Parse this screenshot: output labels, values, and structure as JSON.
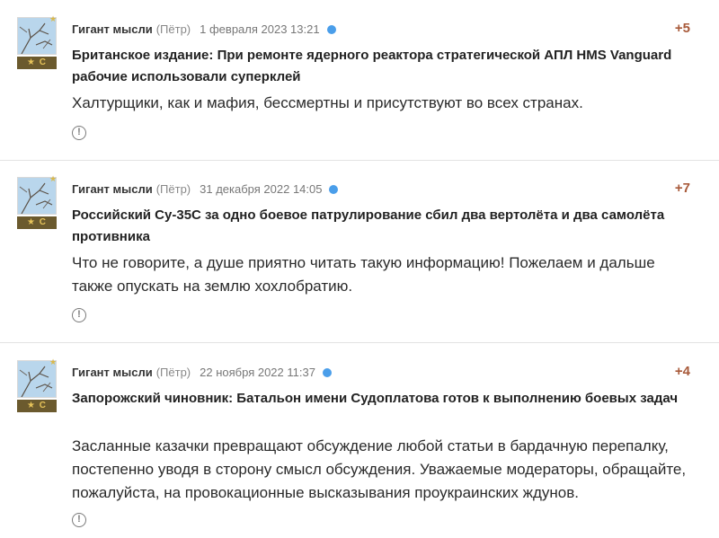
{
  "comments": [
    {
      "author": "Гигант мысли",
      "real_name": "(Пётр)",
      "date": "1 февраля 2023 13:21",
      "rating": "+5",
      "rank_badge": "★ С",
      "title": "Британское издание: При ремонте ядерного реактора стратегической АПЛ HMS Vanguard рабочие использовали суперклей",
      "text": "Халтурщики, как и мафия, бессмертны и присутствуют во всех странах.",
      "report_icon": "alert-circle-icon"
    },
    {
      "author": "Гигант мысли",
      "real_name": "(Пётр)",
      "date": "31 декабря 2022 14:05",
      "rating": "+7",
      "rank_badge": "★ С",
      "title": "Российский Су-35С за одно боевое патрулирование сбил два вертолёта и два самолёта противника",
      "text": "Что не говорите, а душе приятно читать такую информацию! Пожелаем и дальше также опускать на землю хохлобратию.",
      "report_icon": "alert-circle-icon"
    },
    {
      "author": "Гигант мысли",
      "real_name": "(Пётр)",
      "date": "22 ноября 2022 11:37",
      "rating": "+4",
      "rank_badge": "★ С",
      "title": "Запорожский чиновник: Батальон имени Судоплатова готов к выполнению боевых задач",
      "text": "Засланные казачки превращают обсуждение любой статьи в бардачную перепалку, постепенно уводя в сторону смысл обсуждения. Уважаемые модераторы, обращайте, пожалуйста, на провокационные высказывания проукраинских ждунов.",
      "report_icon": "alert-circle-icon"
    }
  ],
  "colors": {
    "rating": "#a85a3a",
    "online_dot": "#4a9eea",
    "rank_bg": "#6b5a2e",
    "rank_fg": "#e6c35a"
  }
}
